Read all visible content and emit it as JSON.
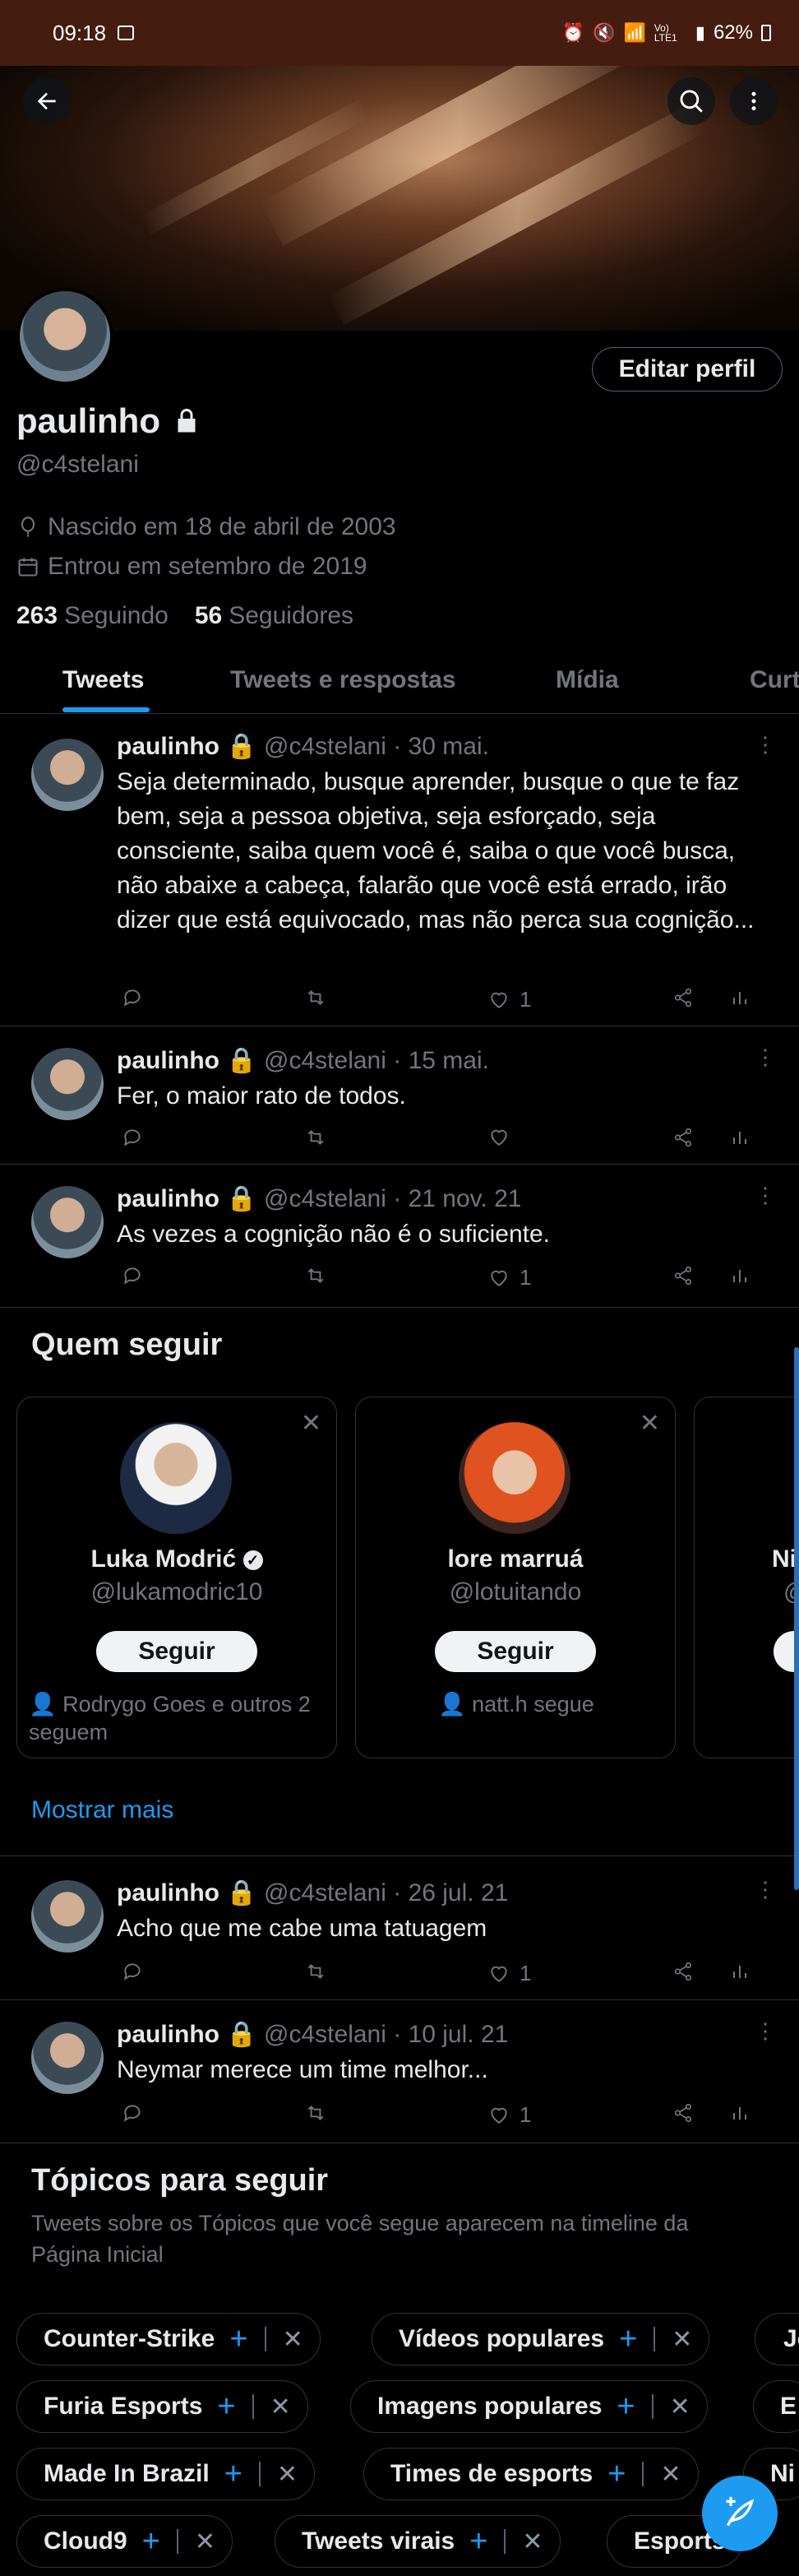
{
  "status_bar": {
    "time": "09:18",
    "battery": "62%",
    "net": "Vo) LTE1"
  },
  "profile": {
    "name": "paulinho",
    "handle": "@c4stelani",
    "edit_label": "Editar perfil",
    "birthday": "Nascido em 18 de abril de 2003",
    "joined": "Entrou em setembro de 2019",
    "following_count": "263",
    "following_label": "Seguindo",
    "followers_count": "56",
    "followers_label": "Seguidores"
  },
  "tabs": [
    "Tweets",
    "Tweets e respostas",
    "Mídia",
    "Curtidas"
  ],
  "tweets": [
    {
      "name": "paulinho",
      "handle": "@c4stelani",
      "date": "30 mai.",
      "text": "Seja determinado, busque aprender, busque o que te faz bem, seja a pessoa objetiva, seja esforçado, seja consciente, saiba quem você é, saiba o que você busca, não abaixe a cabeça, falarão que você está errado, irão dizer que está equivocado, mas não perca sua cognição...",
      "likes": "1"
    },
    {
      "name": "paulinho",
      "handle": "@c4stelani",
      "date": "15 mai.",
      "text": "Fer, o maior rato de todos.",
      "likes": ""
    },
    {
      "name": "paulinho",
      "handle": "@c4stelani",
      "date": "21 nov. 21",
      "text": "As vezes a cognição não é o suficiente.",
      "likes": "1"
    },
    {
      "name": "paulinho",
      "handle": "@c4stelani",
      "date": "26 jul. 21",
      "text": "Acho que me cabe uma tatuagem",
      "likes": "1"
    },
    {
      "name": "paulinho",
      "handle": "@c4stelani",
      "date": "10 jul. 21",
      "text": "Neymar merece um time melhor...",
      "likes": "1"
    }
  ],
  "who_to_follow": {
    "title": "Quem seguir",
    "follow_label": "Seguir",
    "more_label": "Mostrar mais",
    "cards": [
      {
        "name": "Luka Modrić",
        "handle": "@lukamodric10",
        "social": "Rodrygo Goes e outros 2 seguem"
      },
      {
        "name": "lore marruá",
        "handle": "@lotuitando",
        "social": "natt.h segue"
      },
      {
        "name": "Ni",
        "handle": "@"
      }
    ]
  },
  "topics": {
    "title": "Tópicos para seguir",
    "subtitle": "Tweets sobre os Tópicos que você segue aparecem na timeline da Página Inicial",
    "rows": [
      [
        "Counter-Strike",
        "Vídeos populares",
        "Jo"
      ],
      [
        "Furia Esports",
        "Imagens populares",
        "E"
      ],
      [
        "Made In Brazil",
        "Times de esports",
        "Ni"
      ],
      [
        "Cloud9",
        "Tweets virais",
        "Esports"
      ]
    ]
  }
}
